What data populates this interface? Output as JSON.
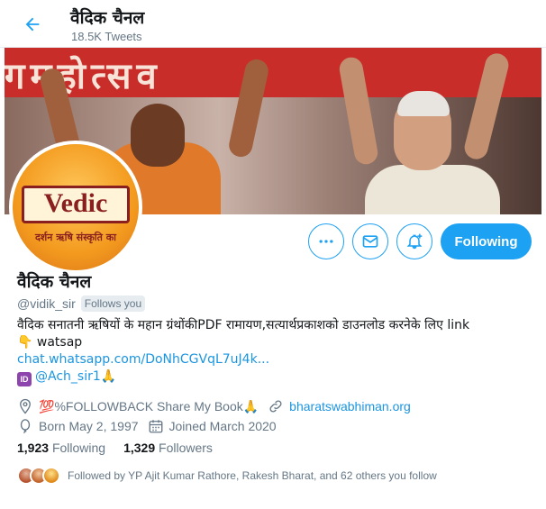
{
  "header": {
    "title": "वैदिक चैनल",
    "tweet_count": "18.5K Tweets",
    "back_icon": "arrow-left-icon"
  },
  "banner": {
    "sign_text": "गमहोत्सव"
  },
  "avatar": {
    "word": "Vedic",
    "tagline": "दर्शन ऋषि संस्कृति का"
  },
  "actions": {
    "more_icon": "more-icon",
    "message_icon": "mail-icon",
    "notify_icon": "bell-plus-icon",
    "follow_label": "Following"
  },
  "profile": {
    "name": "वैदिक चैनल",
    "handle": "@vidik_sir",
    "follows_you": "Follows you",
    "bio_line1": "वैदिक सनातनी ऋषियों के महान ग्रंथोंकीPDF रामायण,सत्यार्थप्रकाशको डाउनलोड करनेके लिए link",
    "bio_line2_emoji": "👇",
    "bio_line2_text": " watsap",
    "bio_link": "chat.whatsapp.com/DoNhCGVqL7uJ4k...",
    "bio_id_badge": "ID",
    "bio_mention": "@Ach_sir1",
    "bio_mention_emoji": "🙏"
  },
  "meta": {
    "location_emoji": "💯",
    "location_text": "%FOLLOWBACK Share My Book",
    "location_end_emoji": "🙏",
    "website": "bharatswabhiman.org",
    "born": "Born May 2, 1997",
    "joined": "Joined March 2020"
  },
  "stats": {
    "following_count": "1,923",
    "following_label": "Following",
    "followers_count": "1,329",
    "followers_label": "Followers"
  },
  "followed_by": {
    "text": "Followed by YP Ajit Kumar Rathore, Rakesh Bharat, and 62 others you follow"
  },
  "colors": {
    "accent": "#1da1f2",
    "link": "#1b95e0",
    "muted": "#657786"
  }
}
